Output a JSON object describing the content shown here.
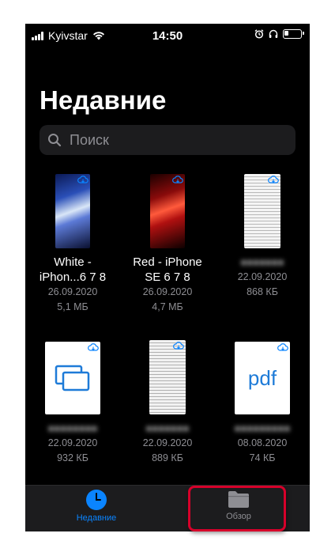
{
  "status_bar": {
    "carrier": "Kyivstar",
    "time": "14:50",
    "icons": [
      "signal-icon",
      "wifi-icon",
      "alarm-icon",
      "headphones-icon",
      "battery-icon"
    ]
  },
  "header": {
    "title": "Недавние"
  },
  "search": {
    "placeholder": "Поиск"
  },
  "files": [
    {
      "name": "White - iPhon...6 7 8",
      "date": "26.09.2020",
      "size": "5,1 МБ",
      "thumb": "white-iphone-wallpaper"
    },
    {
      "name": "Red - iPhone SE 6 7 8",
      "date": "26.09.2020",
      "size": "4,7 МБ",
      "thumb": "red-iphone-wallpaper"
    },
    {
      "name": "",
      "date": "22.09.2020",
      "size": "868 КБ",
      "thumb": "receipt"
    },
    {
      "name": "",
      "date": "22.09.2020",
      "size": "932 КБ",
      "thumb": "pages-doc"
    },
    {
      "name": "",
      "date": "22.09.2020",
      "size": "889 КБ",
      "thumb": "receipt"
    },
    {
      "name": "",
      "date": "08.08.2020",
      "size": "74 КБ",
      "thumb": "pdf",
      "thumb_text": "pdf"
    }
  ],
  "tabs": [
    {
      "label": "Недавние",
      "icon": "clock-icon",
      "active": true
    },
    {
      "label": "Обзор",
      "icon": "folder-icon",
      "active": false
    }
  ],
  "colors": {
    "accent": "#0a84ff",
    "highlight": "#d6002a"
  }
}
